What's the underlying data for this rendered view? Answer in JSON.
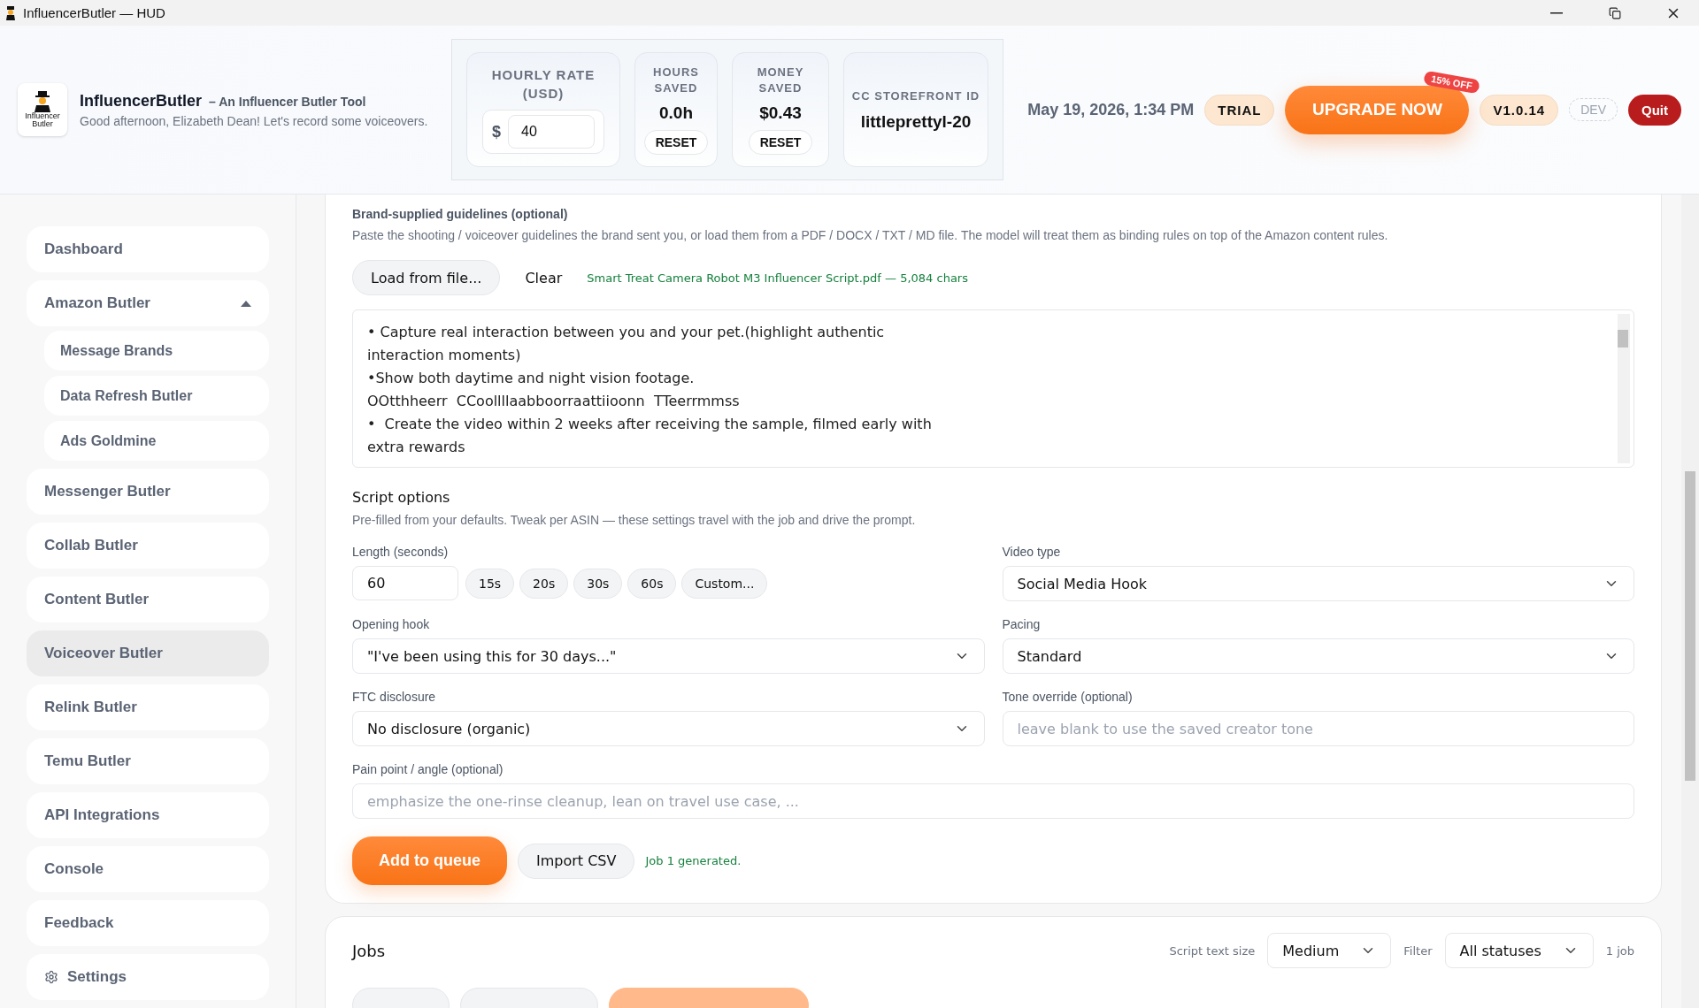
{
  "window": {
    "title": "InfluencerButler — HUD"
  },
  "header": {
    "app_name": "InfluencerButler",
    "tagline": "– An Influencer Butler Tool",
    "greeting": "Good afternoon, Elizabeth Dean! Let's record some voiceovers.",
    "logo_text": "Influencer Butler",
    "stats": [
      {
        "kind": "rate",
        "label": "HOURLY RATE (USD)",
        "currency": "$",
        "value": "40"
      },
      {
        "kind": "counter",
        "label": "HOURS SAVED",
        "value": "0.0h",
        "button": "RESET"
      },
      {
        "kind": "counter",
        "label": "MONEY SAVED",
        "value": "$0.43",
        "button": "RESET"
      },
      {
        "kind": "id",
        "label": "CC STOREFRONT ID",
        "value": "littleprettyl-20"
      }
    ],
    "datetime": "May 19, 2026, 1:34 PM",
    "plan": "TRIAL",
    "upgrade": "UPGRADE NOW",
    "discount": "15% OFF",
    "version": "V1.0.14",
    "env": "DEV",
    "quit": "Quit"
  },
  "sidebar": {
    "items": [
      {
        "label": "Dashboard",
        "selected": false
      },
      {
        "label": "Amazon Butler",
        "selected": false,
        "expanded": true,
        "children": [
          {
            "label": "Message Brands",
            "selected": false
          },
          {
            "label": "Data Refresh Butler",
            "selected": false
          },
          {
            "label": "Ads Goldmine",
            "selected": false
          }
        ]
      },
      {
        "label": "Messenger Butler",
        "selected": false
      },
      {
        "label": "Collab Butler",
        "selected": false
      },
      {
        "label": "Content Butler",
        "selected": false
      },
      {
        "label": "Voiceover Butler",
        "selected": true
      },
      {
        "label": "Relink Butler",
        "selected": false
      },
      {
        "label": "Temu Butler",
        "selected": false
      },
      {
        "label": "API Integrations",
        "selected": false
      },
      {
        "label": "Console",
        "selected": false
      },
      {
        "label": "Feedback",
        "selected": false
      },
      {
        "label": "Settings",
        "selected": false
      }
    ]
  },
  "guidelines": {
    "label": "Brand-supplied guidelines (optional)",
    "description": "Paste the shooting / voiceover guidelines the brand sent you, or load them from a PDF / DOCX / TXT / MD file. The model will treat them as binding rules on top of the Amazon content rules.",
    "load_button": "Load from file...",
    "clear_button": "Clear",
    "file_info": "Smart Treat Camera Robot M3 Influencer Script.pdf — 5,084 chars",
    "text_lines": [
      "• Capture real interaction between you and your pet.(highlight authentic",
      "interaction moments)",
      "•Show both daytime and night vision footage.",
      "OOtthheerr  CCoollllaabboorraattiioonn  TTeerrmmss",
      "•  Create the video within 2 weeks after receiving the sample, filmed early with",
      "extra rewards"
    ]
  },
  "script_options": {
    "title": "Script options",
    "description": "Pre-filled from your defaults. Tweak per ASIN — these settings travel with the job and drive the prompt.",
    "length": {
      "label": "Length (seconds)",
      "value": "60",
      "presets": [
        "15s",
        "20s",
        "30s",
        "60s",
        "Custom..."
      ]
    },
    "video_type": {
      "label": "Video type",
      "value": "Social Media Hook"
    },
    "opening_hook": {
      "label": "Opening hook",
      "value": "\"I've been using this for 30 days...\""
    },
    "pacing": {
      "label": "Pacing",
      "value": "Standard"
    },
    "ftc": {
      "label": "FTC disclosure",
      "value": "No disclosure (organic)"
    },
    "tone": {
      "label": "Tone override (optional)",
      "placeholder": "leave blank to use the saved creator tone"
    },
    "pain_point": {
      "label": "Pain point / angle (optional)",
      "placeholder": "emphasize the one-rinse cleanup, lean on travel use case, ..."
    },
    "add_button": "Add to queue",
    "import_button": "Import CSV",
    "status": "Job 1 generated."
  },
  "jobs": {
    "title": "Jobs",
    "text_size_label": "Script text size",
    "text_size": "Medium",
    "filter_label": "Filter",
    "filter": "All statuses",
    "count": "1 job"
  }
}
